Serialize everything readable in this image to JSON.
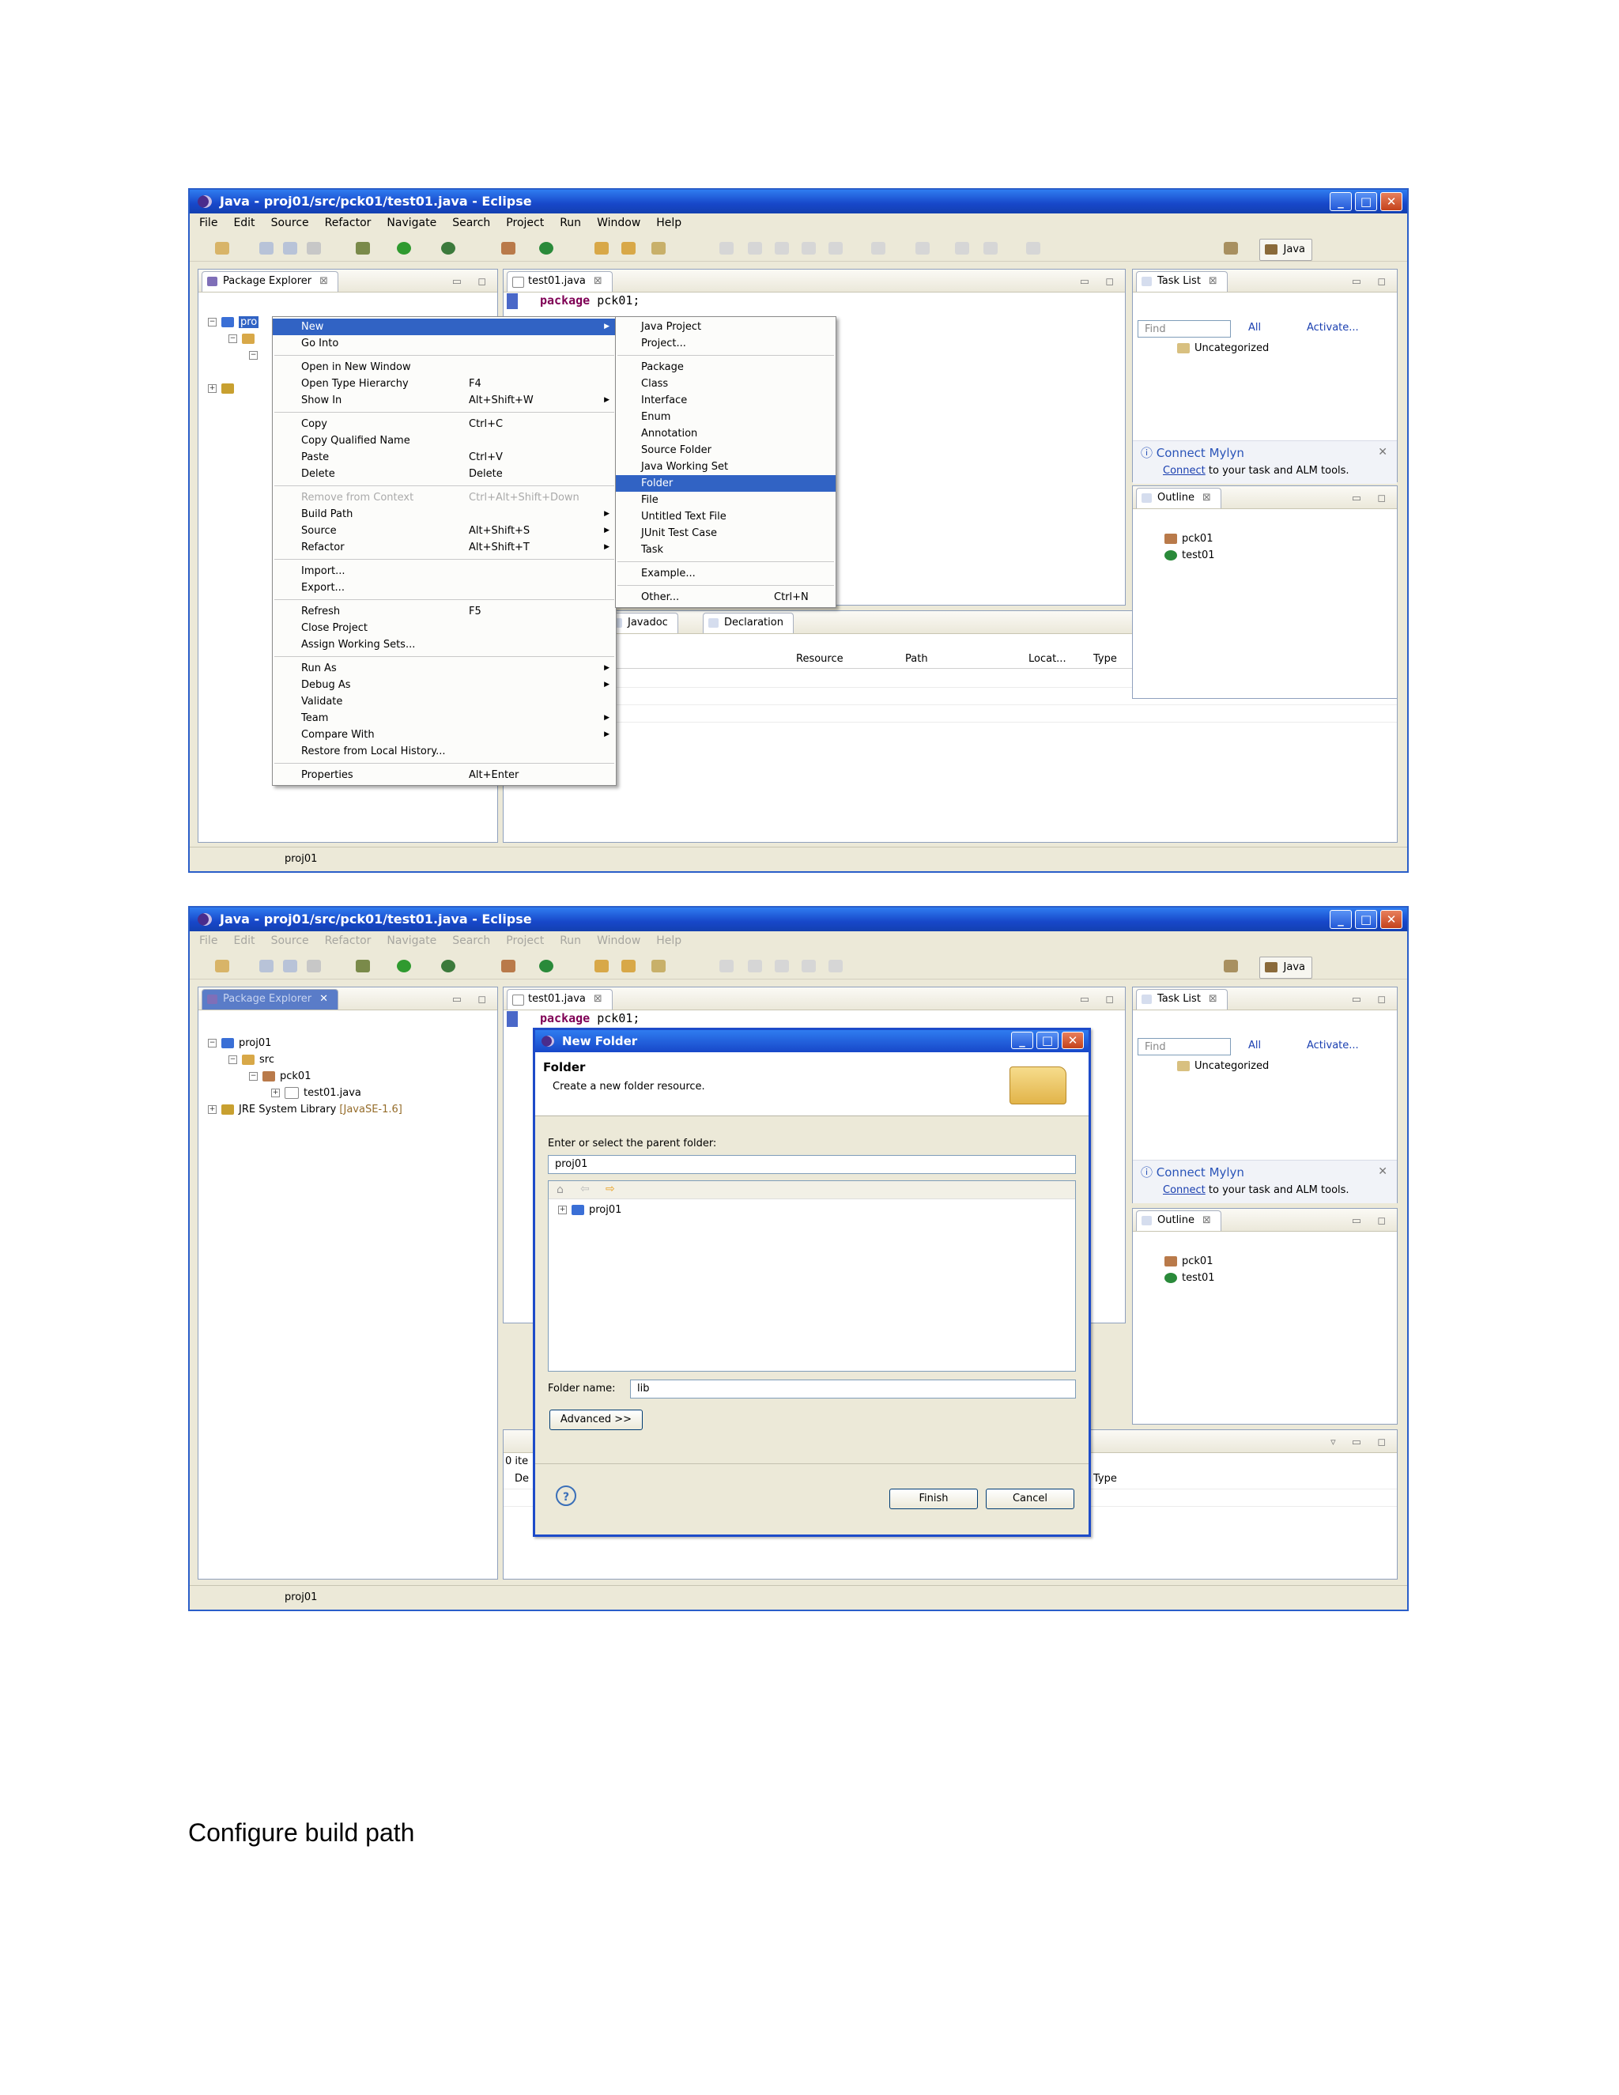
{
  "window_title": "Java - proj01/src/pck01/test01.java - Eclipse",
  "menubar": [
    "File",
    "Edit",
    "Source",
    "Refactor",
    "Navigate",
    "Search",
    "Project",
    "Run",
    "Window",
    "Help"
  ],
  "perspective": "Java",
  "package_explorer": {
    "tab": "Package Explorer",
    "project": "proj01",
    "src": "src",
    "package": "pck01",
    "file": "test01.java",
    "jre": "JRE System Library",
    "jre_version": "[JavaSE-1.6]"
  },
  "editor": {
    "tab": "test01.java",
    "keyword": "package",
    "code": "pck01;"
  },
  "task_list": {
    "tab": "Task List",
    "find_placeholder": "Find",
    "all": "All",
    "activate": "Activate...",
    "uncategorized": "Uncategorized"
  },
  "mylyn": {
    "title": "Connect Mylyn",
    "link": "Connect",
    "text": "to your task and ALM tools."
  },
  "outline": {
    "tab": "Outline",
    "items": [
      "pck01",
      "test01"
    ]
  },
  "bottom_tabs": [
    "Javadoc",
    "Declaration"
  ],
  "problems_columns": [
    "Resource",
    "Path",
    "Locat...",
    "Type"
  ],
  "status_text": "proj01",
  "context_menu": [
    {
      "label": "New",
      "accel": "",
      "submenu": true,
      "selected": true
    },
    {
      "label": "Go Into",
      "accel": ""
    },
    {
      "sep": true
    },
    {
      "label": "Open in New Window",
      "accel": ""
    },
    {
      "label": "Open Type Hierarchy",
      "accel": "F4"
    },
    {
      "label": "Show In",
      "accel": "Alt+Shift+W",
      "submenu": true
    },
    {
      "sep": true
    },
    {
      "label": "Copy",
      "accel": "Ctrl+C"
    },
    {
      "label": "Copy Qualified Name",
      "accel": ""
    },
    {
      "label": "Paste",
      "accel": "Ctrl+V"
    },
    {
      "label": "Delete",
      "accel": "Delete"
    },
    {
      "sep": true
    },
    {
      "label": "Remove from Context",
      "accel": "Ctrl+Alt+Shift+Down",
      "disabled": true
    },
    {
      "label": "Build Path",
      "accel": "",
      "submenu": true
    },
    {
      "label": "Source",
      "accel": "Alt+Shift+S",
      "submenu": true
    },
    {
      "label": "Refactor",
      "accel": "Alt+Shift+T",
      "submenu": true
    },
    {
      "sep": true
    },
    {
      "label": "Import...",
      "accel": ""
    },
    {
      "label": "Export...",
      "accel": ""
    },
    {
      "sep": true
    },
    {
      "label": "Refresh",
      "accel": "F5"
    },
    {
      "label": "Close Project",
      "accel": ""
    },
    {
      "label": "Assign Working Sets...",
      "accel": ""
    },
    {
      "sep": true
    },
    {
      "label": "Run As",
      "accel": "",
      "submenu": true
    },
    {
      "label": "Debug As",
      "accel": "",
      "submenu": true
    },
    {
      "label": "Validate",
      "accel": ""
    },
    {
      "label": "Team",
      "accel": "",
      "submenu": true
    },
    {
      "label": "Compare With",
      "accel": "",
      "submenu": true
    },
    {
      "label": "Restore from Local History...",
      "accel": ""
    },
    {
      "sep": true
    },
    {
      "label": "Properties",
      "accel": "Alt+Enter"
    }
  ],
  "new_submenu": [
    {
      "label": "Java Project",
      "accel": ""
    },
    {
      "label": "Project...",
      "accel": ""
    },
    {
      "sep": true
    },
    {
      "label": "Package",
      "accel": ""
    },
    {
      "label": "Class",
      "accel": ""
    },
    {
      "label": "Interface",
      "accel": ""
    },
    {
      "label": "Enum",
      "accel": ""
    },
    {
      "label": "Annotation",
      "accel": ""
    },
    {
      "label": "Source Folder",
      "accel": ""
    },
    {
      "label": "Java Working Set",
      "accel": ""
    },
    {
      "label": "Folder",
      "accel": "",
      "selected": true
    },
    {
      "label": "File",
      "accel": ""
    },
    {
      "label": "Untitled Text File",
      "accel": ""
    },
    {
      "label": "JUnit Test Case",
      "accel": ""
    },
    {
      "label": "Task",
      "accel": ""
    },
    {
      "sep": true
    },
    {
      "label": "Example...",
      "accel": ""
    },
    {
      "sep": true
    },
    {
      "label": "Other...",
      "accel": "Ctrl+N"
    }
  ],
  "dialog": {
    "title": "New Folder",
    "heading": "Folder",
    "description": "Create a new folder resource.",
    "parent_label": "Enter or select the parent folder:",
    "parent_value": "proj01",
    "tree_item": "proj01",
    "name_label": "Folder name:",
    "name_value": "lib",
    "advanced": "Advanced >>",
    "finish": "Finish",
    "cancel": "Cancel"
  },
  "partial": {
    "items": "0 ite",
    "col_d": "De",
    "type": "Type"
  },
  "caption": "Configure build path"
}
